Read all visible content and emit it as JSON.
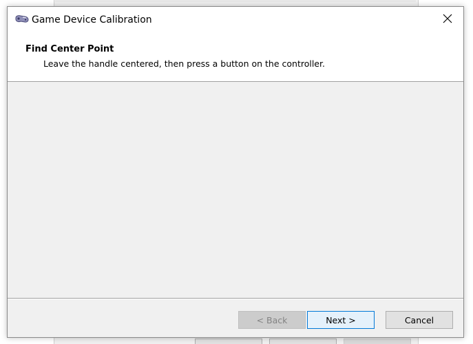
{
  "dialog": {
    "title": "Game Device Calibration",
    "app_icon": "game-controller-icon",
    "close_icon": "close-icon"
  },
  "header": {
    "title": "Find Center Point",
    "subtitle": "Leave the handle centered, then press a button on the controller."
  },
  "buttons": {
    "back": "< Back",
    "next": "Next >",
    "cancel": "Cancel"
  },
  "colors": {
    "accent": "#0078d7",
    "dialog_bg": "#f0f0f0",
    "header_bg": "#ffffff"
  }
}
